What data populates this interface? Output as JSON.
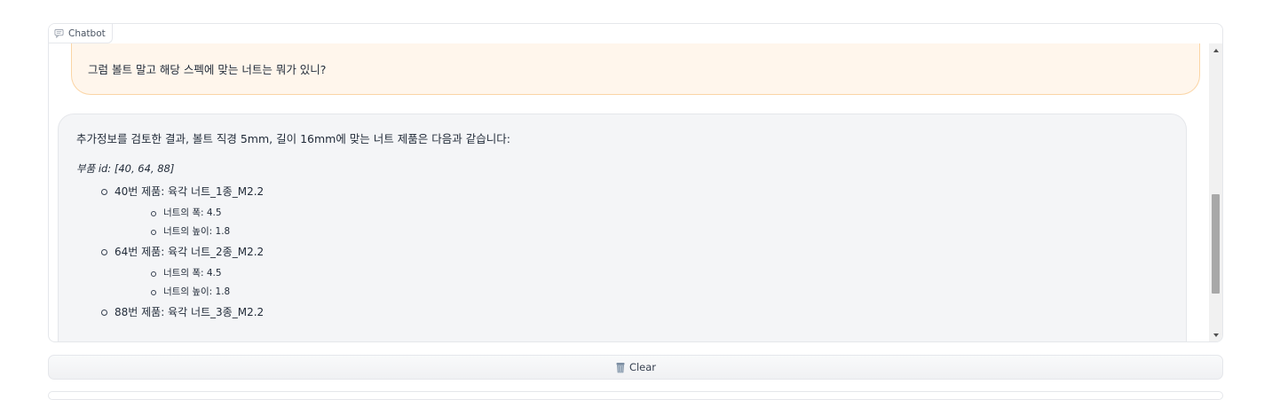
{
  "chatbot": {
    "label": "Chatbot",
    "icon": "chat-icon"
  },
  "messages": {
    "user": {
      "text": "그럼 볼트 말고 해당 스펙에 맞는 너트는 뭐가 있니?"
    },
    "bot": {
      "intro": "추가정보를 검토한 결과, 볼트 직경 5mm, 길이 16mm에 맞는 너트 제품은 다음과 같습니다:",
      "parts_line": "부품 id: [40, 64, 88]",
      "items": [
        {
          "title": "40번 제품: 육각 너트_1종_M2.2",
          "details": [
            "너트의 폭: 4.5",
            "너트의 높이: 1.8"
          ]
        },
        {
          "title": "64번 제품: 육각 너트_2종_M2.2",
          "details": [
            "너트의 폭: 4.5",
            "너트의 높이: 1.8"
          ]
        },
        {
          "title": "88번 제품: 육각 너트_3종_M2.2",
          "details": []
        }
      ]
    }
  },
  "scrollbar": {
    "position_fraction": 0.62
  },
  "clear_button": {
    "icon": "trash-icon",
    "label": "Clear"
  },
  "colors": {
    "user_bubble_bg": "#fff6ec",
    "user_bubble_border": "#fbd5a5",
    "bot_bubble_bg": "#f4f5f7"
  }
}
